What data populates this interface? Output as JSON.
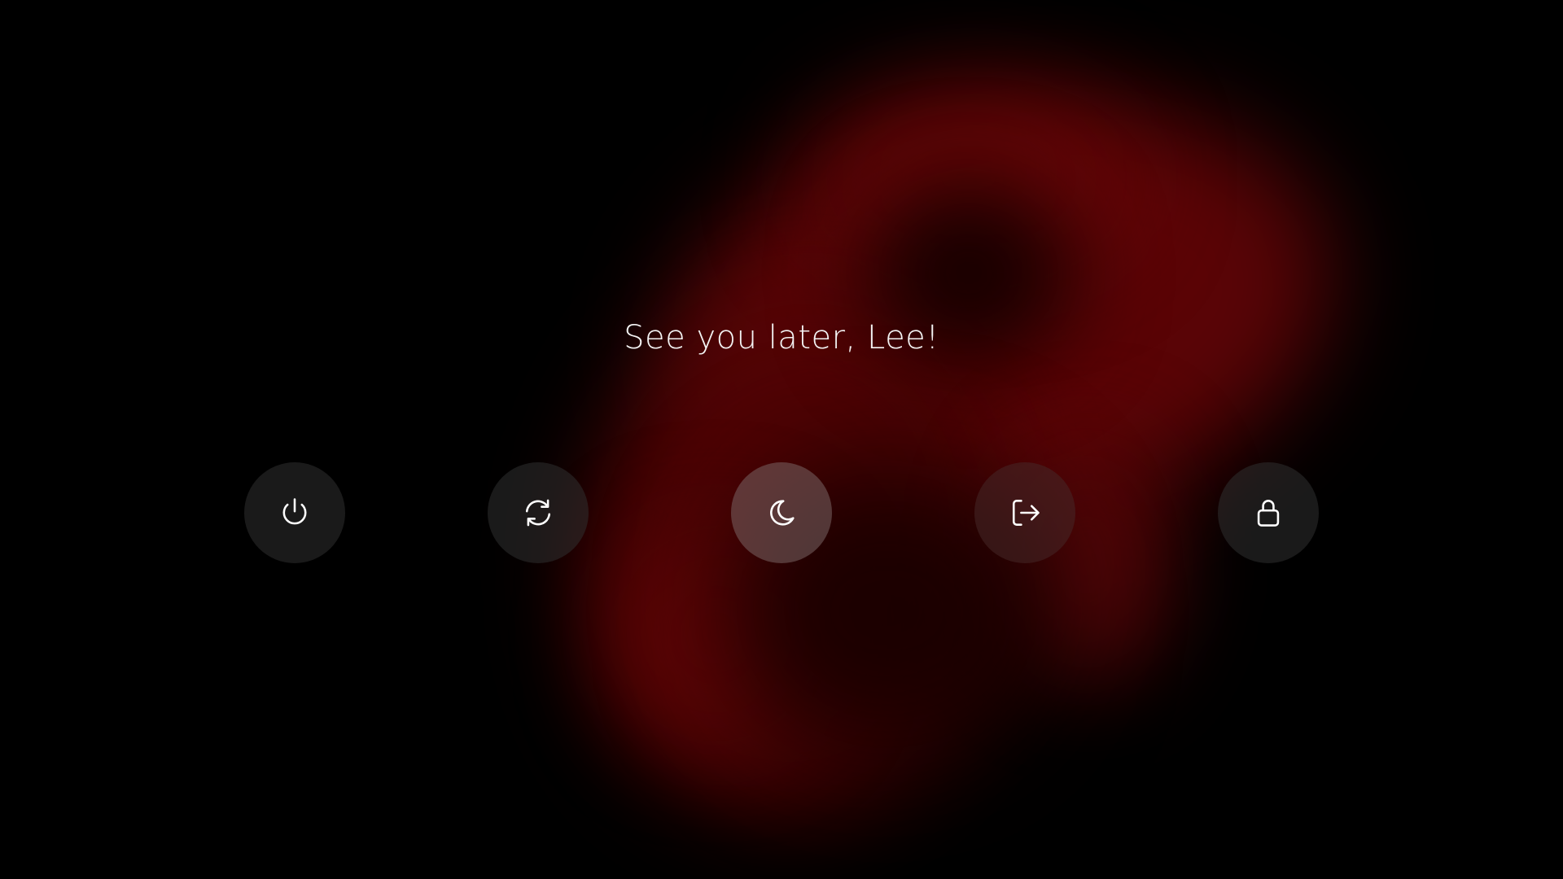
{
  "greeting": "See you later, Lee!",
  "actions": [
    {
      "name": "shutdown",
      "icon": "power-icon"
    },
    {
      "name": "restart",
      "icon": "refresh-icon"
    },
    {
      "name": "sleep",
      "icon": "moon-icon"
    },
    {
      "name": "log-out",
      "icon": "logout-icon"
    },
    {
      "name": "lock",
      "icon": "lock-icon"
    }
  ],
  "colors": {
    "background": "#000000",
    "accent": "#5f0406",
    "button": "#303030",
    "text": "#f3f3f3"
  }
}
